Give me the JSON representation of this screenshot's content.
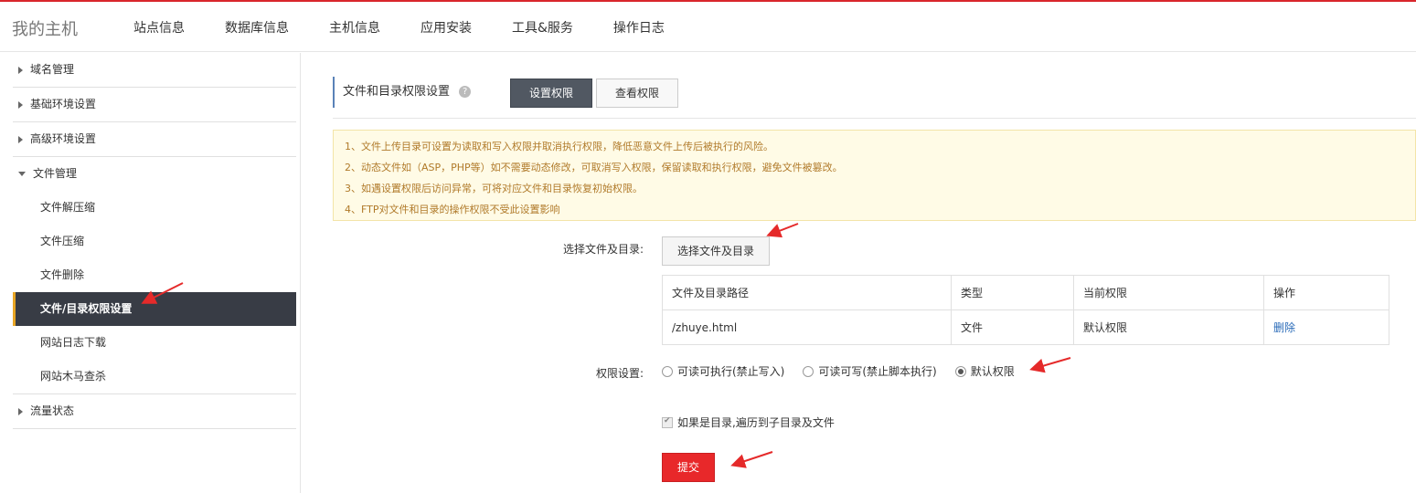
{
  "header": {
    "brand": "我的主机",
    "nav": [
      "站点信息",
      "数据库信息",
      "主机信息",
      "应用安装",
      "工具&服务",
      "操作日志"
    ]
  },
  "sidebar": {
    "groups": [
      {
        "label": "域名管理",
        "expanded": false
      },
      {
        "label": "基础环境设置",
        "expanded": false
      },
      {
        "label": "高级环境设置",
        "expanded": false
      },
      {
        "label": "文件管理",
        "expanded": true,
        "items": [
          "文件解压缩",
          "文件压缩",
          "文件删除",
          "文件/目录权限设置",
          "网站日志下载",
          "网站木马查杀"
        ],
        "active_item": "文件/目录权限设置"
      },
      {
        "label": "流量状态",
        "expanded": false
      }
    ]
  },
  "main": {
    "section_title": "文件和目录权限设置",
    "help_icon": "question-icon",
    "tabs": {
      "set": "设置权限",
      "view": "查看权限"
    },
    "notices": [
      "1、文件上传目录可设置为读取和写入权限并取消执行权限，降低恶意文件上传后被执行的风险。",
      "2、动态文件如（ASP，PHP等）如不需要动态修改，可取消写入权限，保留读取和执行权限，避免文件被篡改。",
      "3、如遇设置权限后访问异常，可将对应文件和目录恢复初始权限。",
      "4、FTP对文件和目录的操作权限不受此设置影响"
    ],
    "select_label": "选择文件及目录:",
    "select_button": "选择文件及目录",
    "table": {
      "headers": [
        "文件及目录路径",
        "类型",
        "当前权限",
        "操作"
      ],
      "rows": [
        {
          "path": "/zhuye.html",
          "type": "文件",
          "perm": "默认权限",
          "action": "删除"
        }
      ]
    },
    "perm_label": "权限设置:",
    "perm_options": [
      "可读可执行(禁止写入)",
      "可读可写(禁止脚本执行)",
      "默认权限"
    ],
    "perm_selected": "默认权限",
    "recursive_label": "如果是目录,遍历到子目录及文件",
    "recursive_checked": true,
    "submit": "提交"
  },
  "colors": {
    "accent_red": "#e8282a",
    "dark_button": "#515862",
    "sidebar_active": "#383c45",
    "notice_text": "#b07a2a"
  }
}
